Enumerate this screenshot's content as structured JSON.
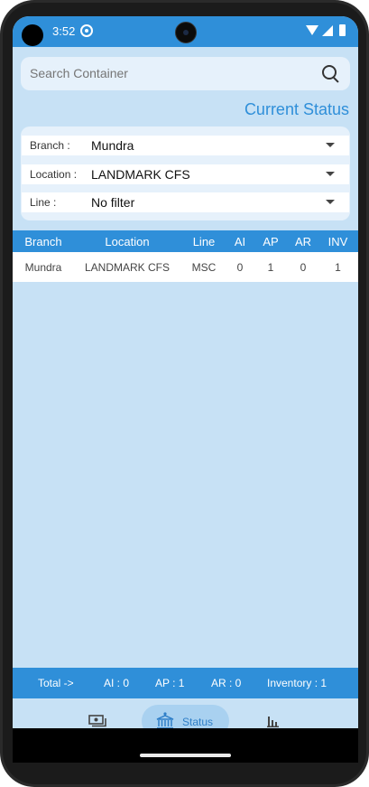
{
  "status_bar": {
    "time": "3:52"
  },
  "search": {
    "placeholder": "Search Container"
  },
  "page_title": "Current Status",
  "filters": {
    "branch": {
      "label": "Branch :",
      "value": "Mundra"
    },
    "location": {
      "label": "Location :",
      "value": "LANDMARK CFS"
    },
    "line": {
      "label": "Line :",
      "value": "No filter"
    }
  },
  "table": {
    "headers": [
      "Branch",
      "Location",
      "Line",
      "AI",
      "AP",
      "AR",
      "INV"
    ],
    "rows": [
      [
        "Mundra",
        "LANDMARK CFS",
        "MSC",
        "0",
        "1",
        "0",
        "1"
      ]
    ]
  },
  "totals": {
    "total_label": "Total ->",
    "ai": "AI : 0",
    "ap": "AP : 1",
    "ar": "AR : 0",
    "inventory": "Inventory : 1"
  },
  "bottom_nav": {
    "items": [
      {
        "icon": "money-icon",
        "label": ""
      },
      {
        "icon": "bank-icon",
        "label": "Status",
        "active": true
      },
      {
        "icon": "bar-chart-icon",
        "label": ""
      }
    ]
  },
  "colors": {
    "primary": "#2f8fd9",
    "background": "#c7e1f5",
    "card": "#e6f1fb"
  }
}
